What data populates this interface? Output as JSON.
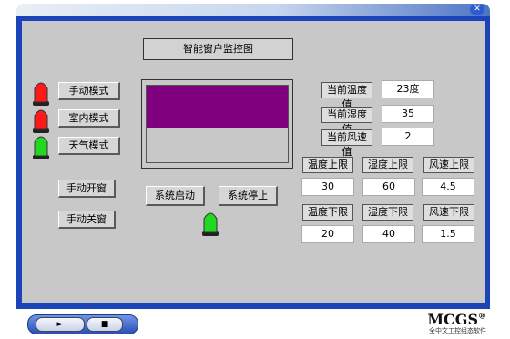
{
  "title": "智能窗户监控图",
  "modes": [
    "手动模式",
    "室内模式",
    "天气模式"
  ],
  "window_buttons": {
    "open": "手动开窗",
    "close": "手动关窗"
  },
  "system_buttons": {
    "start": "系统启动",
    "stop": "系统停止"
  },
  "current": {
    "temp": {
      "label": "当前温度值",
      "value": "23度"
    },
    "humidity": {
      "label": "当前湿度值",
      "value": "35"
    },
    "wind": {
      "label": "当前风速值",
      "value": "2"
    }
  },
  "limits": {
    "temp_upper": {
      "label": "温度上限",
      "value": "30"
    },
    "hum_upper": {
      "label": "湿度上限",
      "value": "60"
    },
    "wind_upper": {
      "label": "风速上限",
      "value": "4.5"
    },
    "temp_lower": {
      "label": "温度下限",
      "value": "20"
    },
    "hum_lower": {
      "label": "湿度下限",
      "value": "40"
    },
    "wind_lower": {
      "label": "风速下限",
      "value": "1.5"
    }
  },
  "window_level": 0.55,
  "lamps": {
    "manual": "red",
    "indoor": "red",
    "weather": "green",
    "system": "green"
  },
  "colors": {
    "red": "#ff1a1a",
    "green": "#22d822",
    "window_fill": "#800080",
    "frame": "#1b44b8"
  },
  "branding": {
    "logo": "MCGS",
    "reg": "®",
    "subtitle": "全中文工控组态软件"
  },
  "player": {
    "play_icon": "play-icon",
    "stop_icon": "stop-icon"
  }
}
